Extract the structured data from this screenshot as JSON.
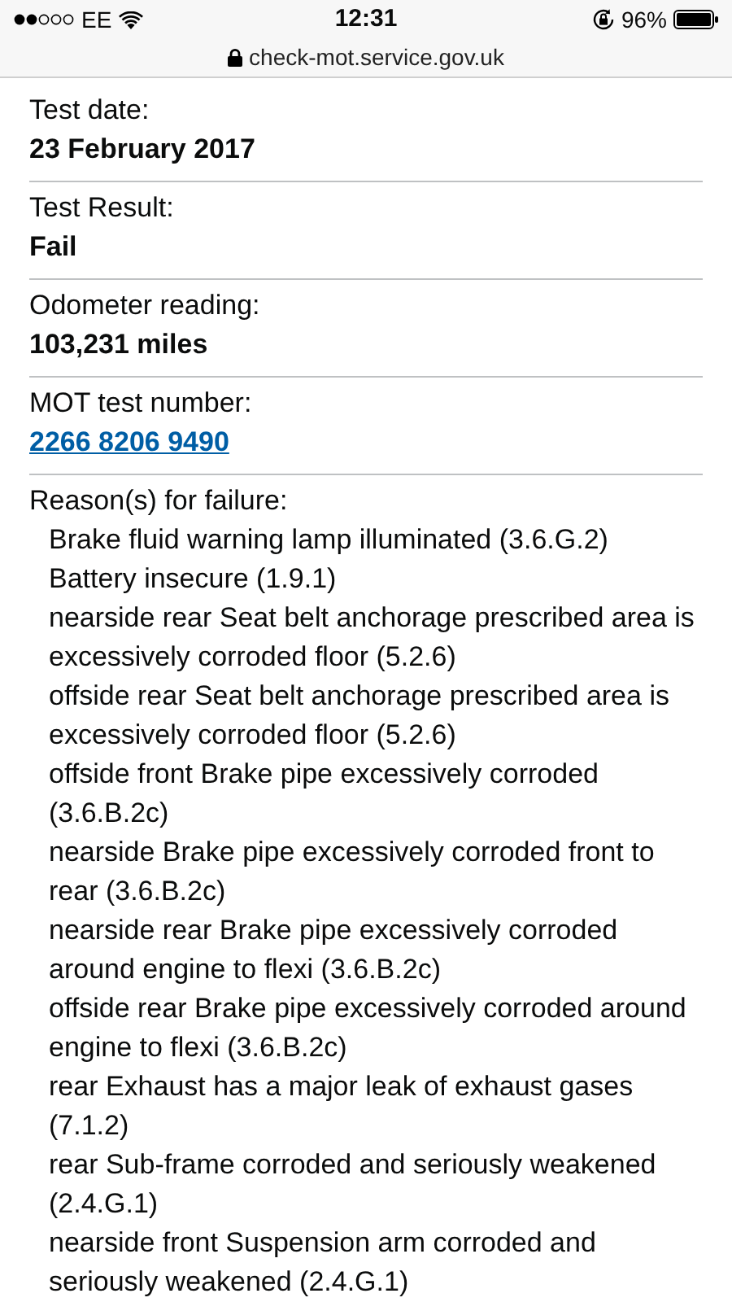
{
  "status_bar": {
    "carrier": "EE",
    "time": "12:31",
    "battery": "96%"
  },
  "address_bar": {
    "url": "check-mot.service.gov.uk"
  },
  "fields": [
    {
      "label": "Test date:",
      "value": "23 February 2017",
      "kind": "text"
    },
    {
      "label": "Test Result:",
      "value": "Fail",
      "kind": "text"
    },
    {
      "label": "Odometer reading:",
      "value": "103,231 miles",
      "kind": "text"
    },
    {
      "label": "MOT test number:",
      "value": "2266 8206 9490",
      "kind": "link"
    }
  ],
  "reasons": {
    "label": "Reason(s) for failure:",
    "items": [
      "Brake fluid warning lamp illuminated (3.6.G.2)",
      "Battery insecure (1.9.1)",
      "nearside rear Seat belt anchorage prescribed area is excessively corroded floor (5.2.6)",
      "offside rear Seat belt anchorage prescribed area is excessively corroded floor (5.2.6)",
      "offside front Brake pipe excessively corroded (3.6.B.2c)",
      "nearside Brake pipe excessively corroded front to rear (3.6.B.2c)",
      "nearside rear Brake pipe excessively corroded around engine to flexi (3.6.B.2c)",
      "offside rear Brake pipe excessively corroded around engine to flexi (3.6.B.2c)",
      "rear Exhaust has a major leak of exhaust gases (7.1.2)",
      "rear Sub-frame corroded and seriously weakened (2.4.G.1)",
      "nearside front Suspension arm corroded and seriously weakened (2.4.G.1)"
    ]
  }
}
